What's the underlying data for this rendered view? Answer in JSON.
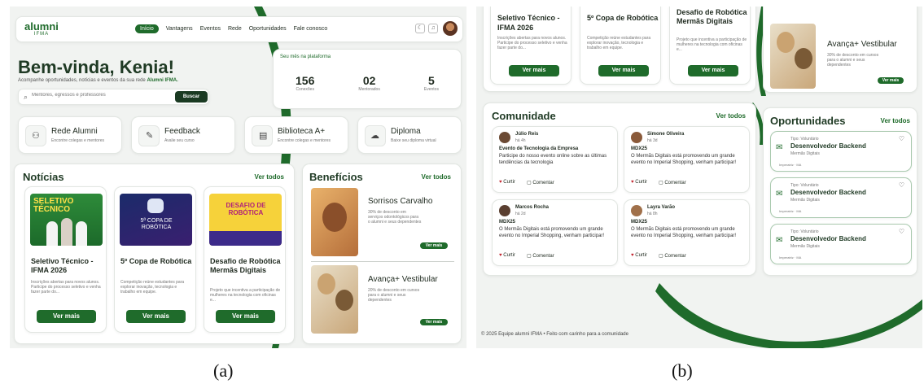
{
  "panel_a": {
    "logo": {
      "main": "alumni",
      "sub": "IFMA"
    },
    "nav": [
      "Início",
      "Vantagens",
      "Eventos",
      "Rede",
      "Oportunidades",
      "Fale conosco"
    ],
    "welcome": {
      "title": "Bem-vinda, Kenia!",
      "subtitle_prefix": "Acompanhe oportunidades, notícias e eventos da sua rede ",
      "subtitle_bold": "Alumni IFMA."
    },
    "search": {
      "placeholder": "Mentores, egressos e professores",
      "button": "Buscar"
    },
    "stats": {
      "title": "Seu mês na plataforma",
      "items": [
        {
          "value": "156",
          "label": "Conexões"
        },
        {
          "value": "02",
          "label": "Mentorados"
        },
        {
          "value": "5",
          "label": "Eventos"
        }
      ]
    },
    "quick_links": [
      {
        "title": "Rede Alumni",
        "sub": "Encontre colegas e mentores",
        "icon": "people-icon"
      },
      {
        "title": "Feedback",
        "sub": "Avalie seu curso",
        "icon": "feedback-icon"
      },
      {
        "title": "Biblioteca A+",
        "sub": "Encontre colegas e mentores",
        "icon": "book-icon"
      },
      {
        "title": "Diploma",
        "sub": "Baixe seu diploma virtual",
        "icon": "cloud-download-icon"
      }
    ],
    "news": {
      "title": "Notícias",
      "see_all": "Ver todos",
      "items": [
        {
          "img_text": "SELETIVO TÉCNICO",
          "title": "Seletivo Técnico - IFMA 2026",
          "desc": "Inscrições abertas para novos alunos. Participe do processo seletivo e venha fazer parte do...",
          "button": "Ver mais"
        },
        {
          "img_text": "5ª COPA DE ROBÓTICA",
          "title": "5º Copa de Robótica",
          "desc": "Competição reúne estudantes para explorar inovação, tecnologia e trabalho em equipe.",
          "button": "Ver mais"
        },
        {
          "img_text": "DESAFIO DE ROBÓTICA",
          "title": "Desafio de Robótica Mermãs Digitais",
          "desc": "Projeto que incentiva a participação de mulheres na tecnologia com oficinas e...",
          "button": "Ver mais"
        }
      ]
    },
    "benefits": {
      "title": "Benefícios",
      "see_all": "Ver todos",
      "items": [
        {
          "title": "Sorrisos Carvalho",
          "desc": "30% de desconto em serviços odontológicos para o alumni e seus dependentes",
          "button": "Ver mais"
        },
        {
          "title": "Avança+ Vestibular",
          "desc": "20% de desconto em cursos para o alumni e seus dependentes",
          "button": "Ver mais"
        }
      ]
    }
  },
  "panel_b": {
    "news_cont": [
      {
        "title": "Seletivo Técnico - IFMA 2026",
        "desc": "Inscrições abertas para novos alunos. Participe do processo seletivo e venha fazer parte do...",
        "button": "Ver mais"
      },
      {
        "title": "5º Copa de Robótica",
        "desc": "Competição reúne estudantes para explorar inovação, tecnologia e trabalho em equipe.",
        "button": "Ver mais"
      },
      {
        "title": "Desafio de Robótica Mermãs Digitais",
        "desc": "Projeto que incentiva a participação de mulheres na tecnologia com oficinas e...",
        "button": "Ver mais"
      }
    ],
    "benefit_cont": {
      "title": "Avança+ Vestibular",
      "desc": "30% de desconto em cursos para o alumni e seus dependentes",
      "button": "Ver mais"
    },
    "community": {
      "title": "Comunidade",
      "see_all": "Ver todos",
      "posts": [
        {
          "author": "Júlio Reis",
          "time": "há 4h",
          "headline": "Evento de Tecnologia da Empresa",
          "body": "Participe do nosso evento online sobre as últimas tendências da tecnologia",
          "like": "Curtir",
          "comment": "Comentar"
        },
        {
          "author": "Simone Oliveira",
          "time": "há 3d",
          "headline": "MDX25",
          "body": "O Mermãs Digitais está promovendo um grande evento no Imperial Shopping, venham participar!",
          "like": "Curtir",
          "comment": "Comentar"
        },
        {
          "author": "Marcos Rocha",
          "time": "há 2d",
          "headline": "MDX25",
          "body": "O Mermãs Digitais está promovendo um grande evento no Imperial Shopping, venham participar!",
          "like": "Curtir",
          "comment": "Comentar"
        },
        {
          "author": "Layra Varão",
          "time": "há 8h",
          "headline": "MDX25",
          "body": "O Mermãs Digitais está promovendo um grande evento no Imperial Shopping, venham participar!",
          "like": "Curtir",
          "comment": "Comentar"
        }
      ]
    },
    "opportunities": {
      "title": "Oportunidades",
      "see_all": "Ver todos",
      "items": [
        {
          "type": "Tipo: Voluntário",
          "title": "Desenvolvedor Backend",
          "org": "Mermãs Digitais",
          "loc": "Imperatriz · MA"
        },
        {
          "type": "Tipo: Voluntário",
          "title": "Desenvolvedor Backend",
          "org": "Mermãs Digitais",
          "loc": "Imperatriz · MA"
        },
        {
          "type": "Tipo: Voluntário",
          "title": "Desenvolvedor Backend",
          "org": "Mermãs Digitais",
          "loc": "Imperatriz · MA"
        }
      ]
    },
    "footer": "© 2025 Equipe alumni IFMA • Feito com carinho para a comunidade"
  },
  "captions": {
    "a": "(a)",
    "b": "(b)"
  }
}
